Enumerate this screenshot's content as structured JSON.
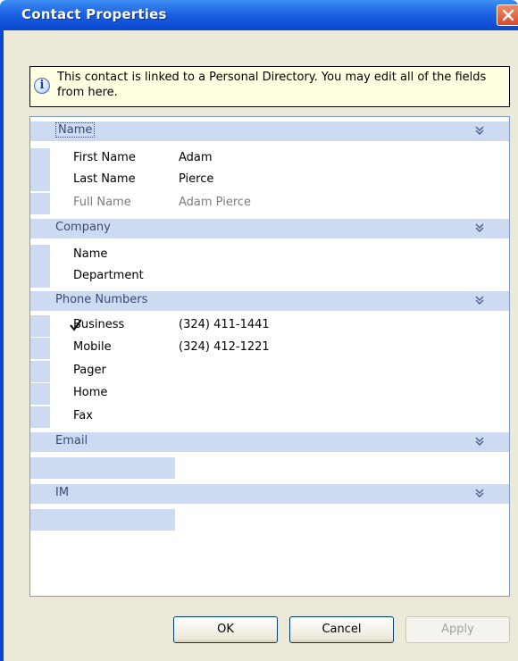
{
  "window": {
    "title": "Contact Properties"
  },
  "info": {
    "text": "This contact is linked to a Personal Directory.   You may edit all of the fields from here."
  },
  "sections": {
    "name": {
      "label": "Name",
      "fields": [
        {
          "label": "First Name",
          "value": "Adam"
        },
        {
          "label": "Last Name",
          "value": "Pierce"
        },
        {
          "label": "Full Name",
          "value": "Adam Pierce"
        }
      ]
    },
    "company": {
      "label": "Company",
      "fields": [
        {
          "label": "Name",
          "value": ""
        },
        {
          "label": "Department",
          "value": ""
        }
      ]
    },
    "phone": {
      "label": "Phone Numbers",
      "fields": [
        {
          "label": "Business",
          "value": "(324) 411-1441",
          "checked": true
        },
        {
          "label": "Mobile",
          "value": "(324) 412-1221"
        },
        {
          "label": "Pager",
          "value": ""
        },
        {
          "label": "Home",
          "value": ""
        },
        {
          "label": "Fax",
          "value": ""
        }
      ]
    },
    "email": {
      "label": "Email"
    },
    "im": {
      "label": "IM"
    }
  },
  "buttons": {
    "ok": "OK",
    "cancel": "Cancel",
    "apply": "Apply"
  },
  "colors": {
    "titlebar": "#1b5ee0",
    "category": "#ccdaf2",
    "info_bg": "#ffffe1",
    "dialog_bg": "#ece9d8"
  }
}
